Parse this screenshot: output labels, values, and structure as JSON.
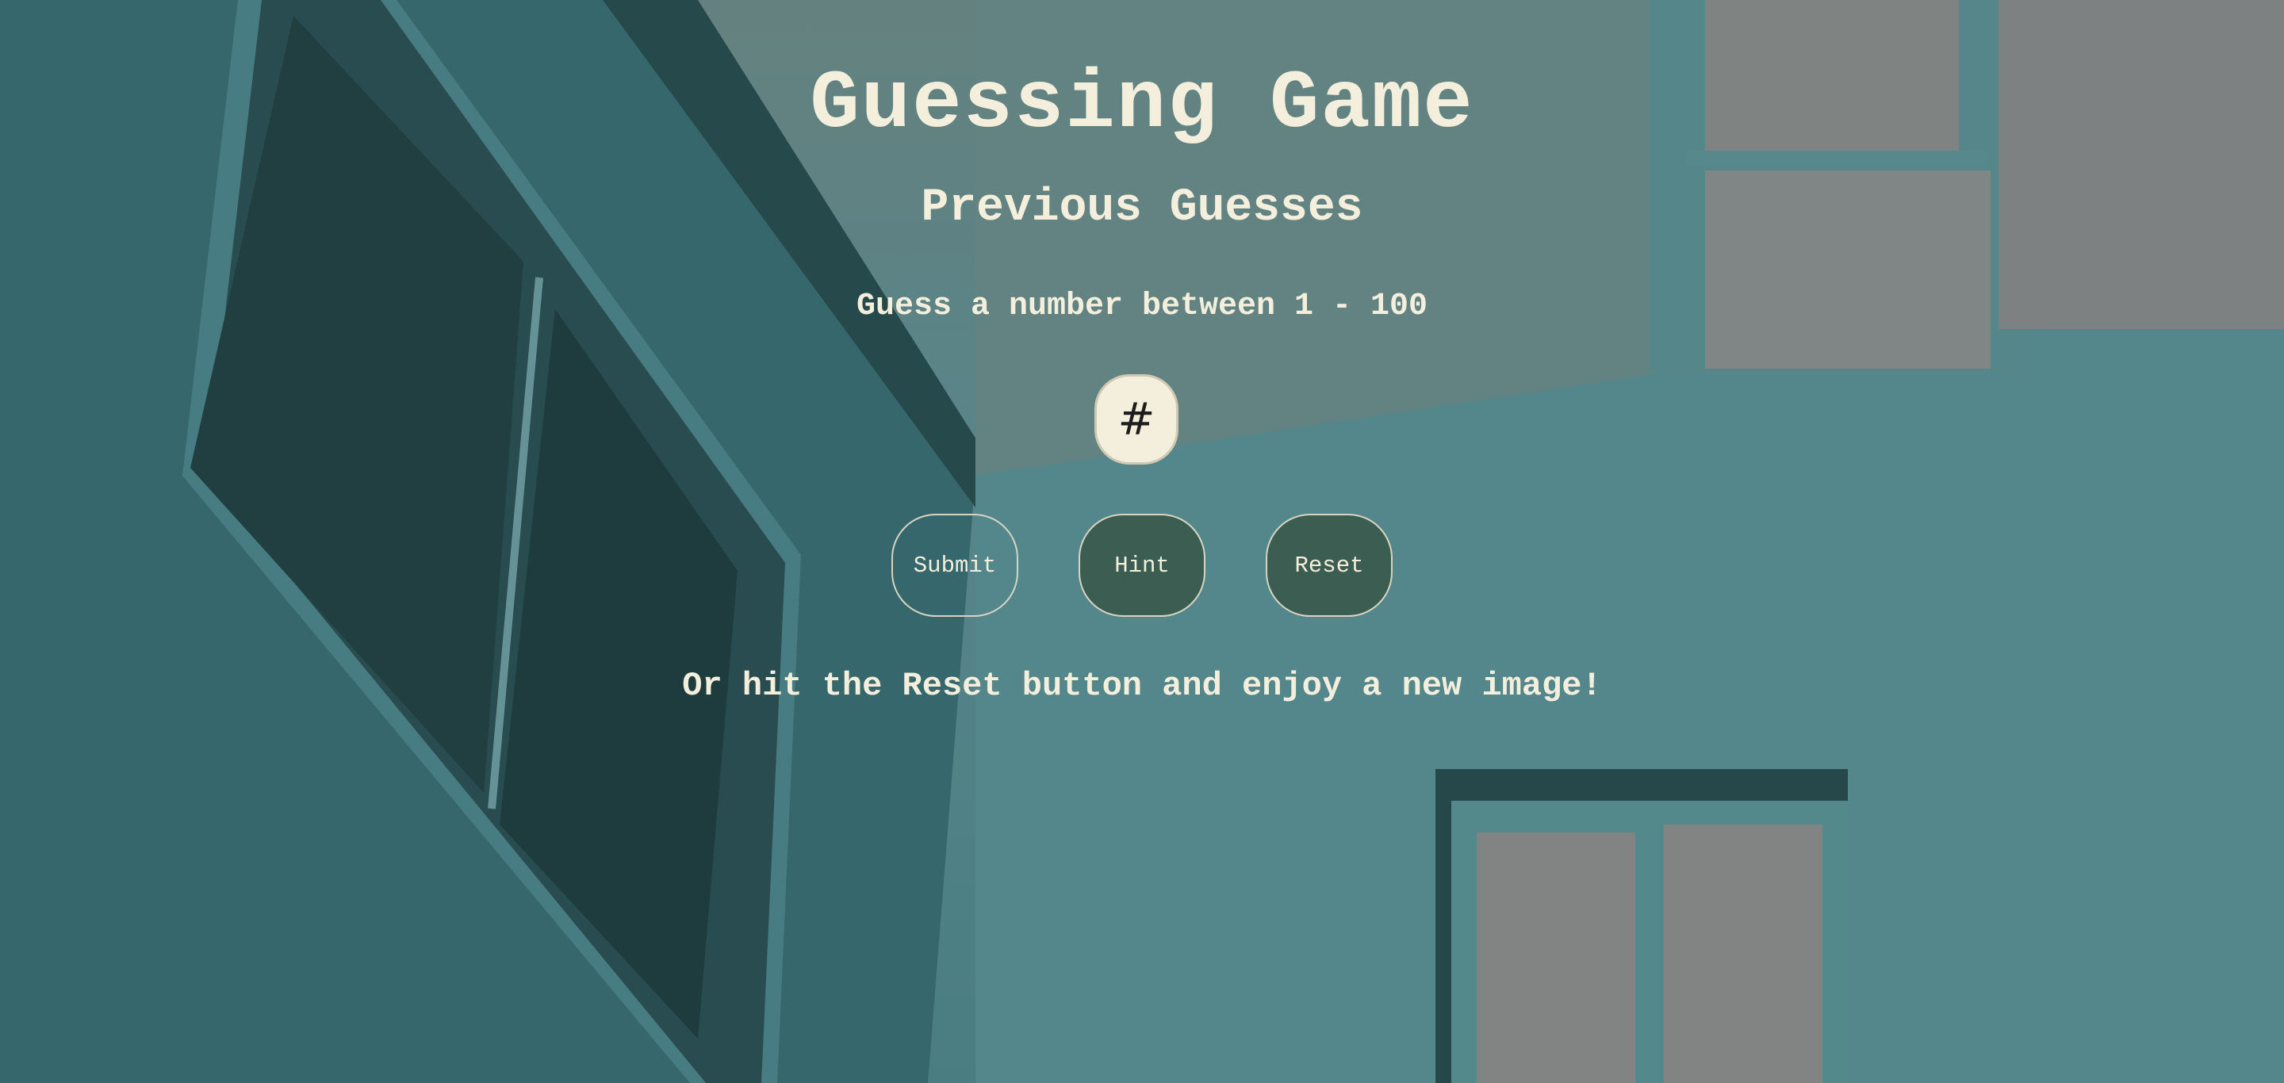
{
  "header": {
    "title": "Guessing Game",
    "previous_guesses_label": "Previous Guesses"
  },
  "game": {
    "prompt": "Guess a number between 1 - 100",
    "input_placeholder": "#",
    "input_value": ""
  },
  "buttons": {
    "submit_label": "Submit",
    "hint_label": "Hint",
    "reset_label": "Reset"
  },
  "footer": {
    "message": "Or hit the Reset button and enjoy a new image!"
  },
  "colors": {
    "text": "#f3efdc",
    "button_fill": "#385646",
    "wall": "#5f9095"
  }
}
